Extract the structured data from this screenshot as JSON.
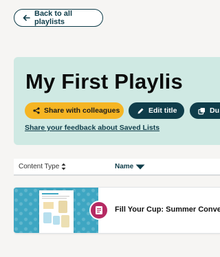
{
  "nav": {
    "back_label": "Back to all playlists"
  },
  "playlist": {
    "title": "My First Playlis",
    "share_label": "Share with colleagues",
    "edit_label": "Edit title",
    "duplicate_label": "Du",
    "feedback_link": "Share your feedback about Saved Lists"
  },
  "sort": {
    "content_type_label": "Content Type",
    "name_label": "Name"
  },
  "resources": [
    {
      "title": "Fill Your Cup: Summer Conve",
      "icon": "document-icon"
    }
  ],
  "colors": {
    "header_bg": "#cfe9e3",
    "share_button": "#f5b523",
    "dark_button": "#0f3d4a",
    "badge": "#b52a63",
    "thumb_bg": "#3ea6c2"
  }
}
